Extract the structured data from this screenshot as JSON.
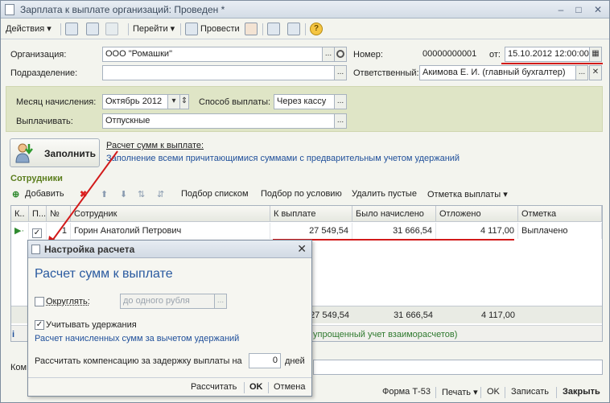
{
  "window": {
    "title": "Зарплата к выплате организаций: Проведен *",
    "minimize": "–",
    "maximize": "□",
    "close": "✕"
  },
  "toolbar": {
    "actions": "Действия",
    "goto": "Перейти",
    "post": "Провести"
  },
  "header": {
    "org_label": "Организация:",
    "org_value": "ООО \"Ромашки\"",
    "dept_label": "Подразделение:",
    "dept_value": "",
    "num_label": "Номер:",
    "num_value": "00000000001",
    "date_label": "от:",
    "date_value": "15.10.2012 12:00:00",
    "resp_label": "Ответственный:",
    "resp_value": "Акимова Е. И. (главный бухгалтер)"
  },
  "panel": {
    "month_label": "Месяц начисления:",
    "month_value": "Октябрь 2012",
    "method_label": "Способ выплаты:",
    "method_value": "Через кассу",
    "pay_label": "Выплачивать:",
    "pay_value": "Отпускные"
  },
  "fill": {
    "button": "Заполнить",
    "calc_link": "Расчет сумм к выплате:",
    "calc_desc": "Заполнение всеми причитающимися суммами с предварительным учетом удержаний"
  },
  "employees": {
    "title": "Сотрудники",
    "toolbar": {
      "add": "Добавить",
      "pick_list": "Подбор списком",
      "pick_cond": "Подбор по условию",
      "delete_empty": "Удалить пустые",
      "mark_payment": "Отметка выплаты"
    },
    "columns": [
      "К..",
      "П...",
      "№",
      "Сотрудник",
      "К выплате",
      "Было начислено",
      "Отложено",
      "Отметка"
    ],
    "rows": [
      {
        "num": "1",
        "name": "Горин Анатолий Петрович",
        "to_pay": "27 549,54",
        "accrued": "31 666,54",
        "deferred": "4 117,00",
        "mark": "Выплачено"
      }
    ],
    "totals": {
      "to_pay": "27 549,54",
      "accrued": "31 666,54",
      "deferred": "4 117,00"
    }
  },
  "info_tail": "упрощенный учет взаиморасчетов)",
  "comment_label": "Ком",
  "bottom": {
    "form": "Форма Т-53",
    "print": "Печать",
    "ok": "OK",
    "save": "Записать",
    "close": "Закрыть"
  },
  "dialog": {
    "title": "Настройка расчета",
    "heading": "Расчет сумм к выплате",
    "round_label": "Округлять:",
    "round_placeholder": "до одного рубля",
    "deduct_label": "Учитывать удержания",
    "deduct_desc": "Расчет начисленных сумм за вычетом удержаний",
    "comp_label": "Рассчитать компенсацию за задержку выплаты на",
    "comp_value": "0",
    "comp_unit": "дней",
    "btn_calc": "Рассчитать",
    "btn_ok": "OK",
    "btn_cancel": "Отмена"
  },
  "colors": {
    "annotation_red": "#d21a1a",
    "link_blue": "#1f4f9a",
    "green_text": "#5a7d1c"
  }
}
